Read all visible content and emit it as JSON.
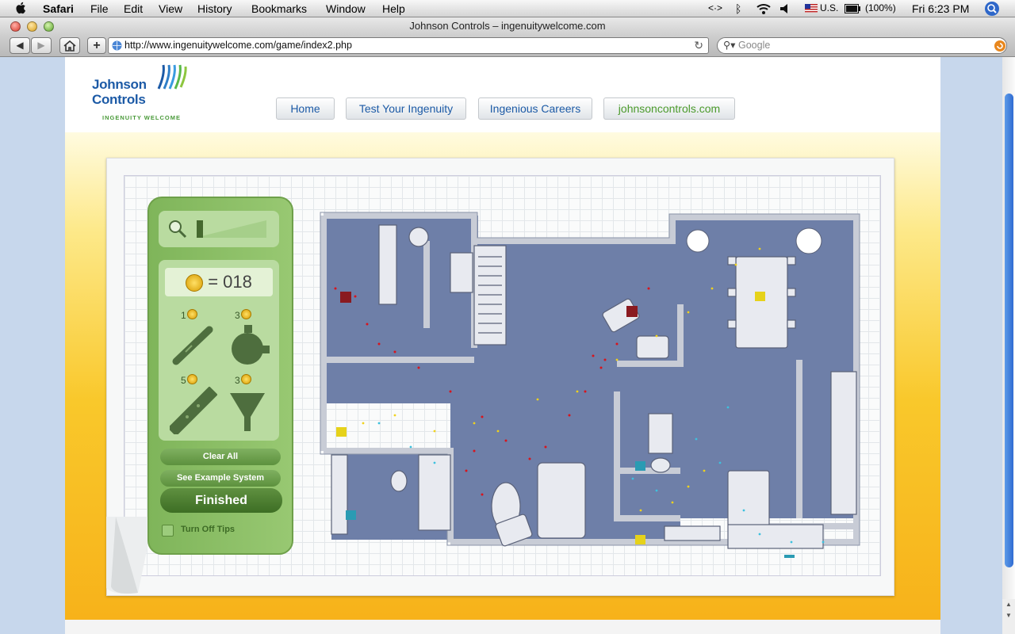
{
  "menubar": {
    "app": "Safari",
    "items": [
      "File",
      "Edit",
      "View",
      "History",
      "Bookmarks",
      "Window",
      "Help"
    ],
    "input_locale": "U.S.",
    "battery": "(100%)",
    "clock": "Fri 6:23 PM"
  },
  "window": {
    "title": "Johnson Controls – ingenuitywelcome.com"
  },
  "toolbar": {
    "url": "http://www.ingenuitywelcome.com/game/index2.php",
    "search_placeholder": "Google"
  },
  "site": {
    "logo_line1": "Johnson",
    "logo_line2": "Controls",
    "logo_tagline": "INGENUITY WELCOME",
    "nav": [
      "Home",
      "Test Your Ingenuity",
      "Ingenious Careers",
      "johnsoncontrols.com"
    ]
  },
  "game": {
    "coins_label": "= 018",
    "parts": [
      {
        "cost": "1",
        "name": "pipe"
      },
      {
        "cost": "3",
        "name": "pump"
      },
      {
        "cost": "5",
        "name": "wide-pipe"
      },
      {
        "cost": "3",
        "name": "funnel"
      }
    ],
    "zoom_level": 0.2,
    "buttons": {
      "clear_all": "Clear All",
      "example": "See Example System",
      "finished": "Finished"
    },
    "tips_label": "Turn Off Tips"
  },
  "colors": {
    "floor": "#6e7fa8",
    "wall": "#c8ccd6",
    "panel_green": "#8cc066",
    "brand_blue": "#1c5aa6"
  }
}
